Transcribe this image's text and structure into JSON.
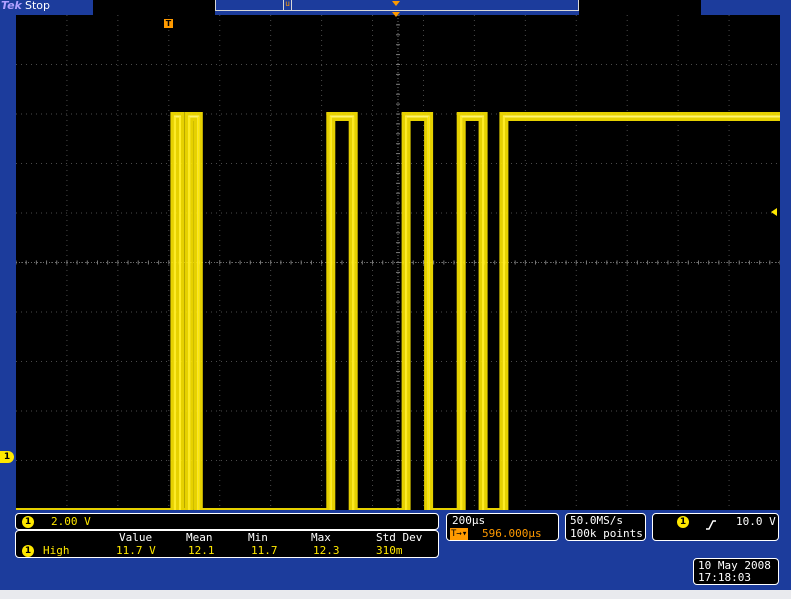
{
  "status_bar": {
    "brand": "Tek",
    "acquisition_state": "Stop"
  },
  "record_view": {
    "window_marker": "u"
  },
  "trigger_position_marker": "T",
  "channel1_ground_marker": "1",
  "channel_panel": {
    "channel": "1",
    "vertical_scale": "2.00 V"
  },
  "measurement_table": {
    "headers": [
      "Value",
      "Mean",
      "Min",
      "Max",
      "Std Dev"
    ],
    "rows": [
      {
        "channel": "1",
        "name": "High",
        "value": "11.7 V",
        "mean": "12.1",
        "min": "11.7",
        "max": "12.3",
        "std_dev": "310m"
      }
    ]
  },
  "horizontal_panel": {
    "time_per_div": "200µs",
    "delay_icon": "T→▾",
    "delay": "596.000µs"
  },
  "acquisition_panel": {
    "sample_rate": "50.0MS/s",
    "record_length": "100k points"
  },
  "trigger_panel": {
    "channel": "1",
    "slope_icon": "rising-edge-icon",
    "level": "10.0 V"
  },
  "datetime": {
    "date": "10 May 2008",
    "time": "17:18:03"
  },
  "colors": {
    "frame": "#1c3c9c",
    "trace": "#ffe800",
    "accent": "#ff9a00",
    "screen": "#000000"
  },
  "chart_data": {
    "type": "line",
    "title": "",
    "xlabel": "",
    "ylabel": "",
    "grid": true,
    "divisions": {
      "x": 15,
      "y": 10
    },
    "ylim": [
      -10,
      10
    ],
    "xlim": [
      0,
      15
    ],
    "series": [
      {
        "values_description": "",
        "x": [
          0,
          3.12,
          3.12,
          3.22,
          3.22,
          3.4,
          3.4,
          3.58,
          3.58,
          6.18,
          6.18,
          6.42,
          6.42,
          6.62,
          6.62,
          7.66,
          7.66,
          8.1,
          8.1,
          8.74,
          8.74,
          9.17,
          9.17,
          9.58,
          9.58,
          9.88,
          9.88,
          15
        ],
        "y": [
          -10.1,
          -10.1,
          5.9,
          5.9,
          -10.1,
          -10.1,
          5.9,
          5.9,
          -10.1,
          -10.1,
          5.9,
          5.9,
          5.9,
          5.9,
          -10.1,
          -10.1,
          5.9,
          5.9,
          -10.1,
          -10.1,
          5.9,
          5.9,
          -10.1,
          -10.1,
          5.9,
          5.9,
          5.9,
          5.9
        ]
      }
    ]
  }
}
